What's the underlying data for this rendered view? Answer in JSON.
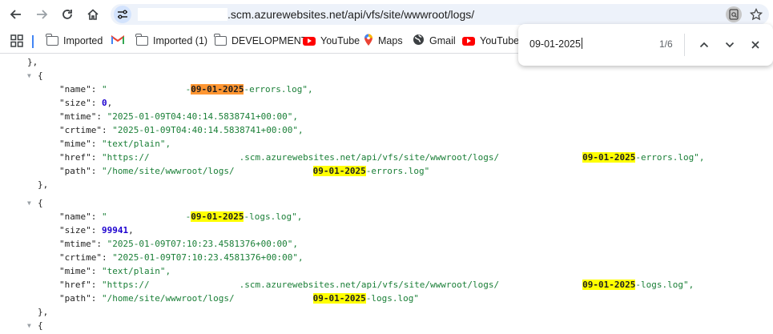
{
  "browser": {
    "url": {
      "visible_text": ".scm.azurewebsites.net/api/vfs/site/wwwroot/logs/"
    },
    "icons": [
      "back-icon",
      "forward-icon",
      "reload-icon",
      "home-icon",
      "site-info-icon",
      "page-search-icon",
      "star-icon"
    ]
  },
  "bookmarks": {
    "items": [
      {
        "label": "Imported",
        "icon": "folder-icon"
      },
      {
        "label": "",
        "icon": "gmail-icon"
      },
      {
        "label": "Imported (1)",
        "icon": "folder-icon"
      },
      {
        "label": "DEVELOPMENT",
        "icon": "folder-icon"
      },
      {
        "label": "YouTube",
        "icon": "youtube-icon"
      },
      {
        "label": "Maps",
        "icon": "maps-icon"
      },
      {
        "label": "Gmail",
        "icon": "globe-icon"
      },
      {
        "label": "YouTube",
        "icon": "youtube-icon"
      }
    ]
  },
  "find": {
    "query": "09-01-2025",
    "count": "1/6"
  },
  "json": {
    "close_obj": "},",
    "open_obj": "{",
    "entry1": {
      "name_key": "\"name\"",
      "name_prefix": "\"",
      "name_dash": "-",
      "date": "09-01-2025",
      "name_suffix": "-errors.log\",",
      "size_key": "\"size\"",
      "size_val": "0",
      "mtime_key": "\"mtime\"",
      "mtime_val": "\"2025-01-09T04:40:14.5838741+00:00\",",
      "crtime_key": "\"crtime\"",
      "crtime_val": "\"2025-01-09T04:40:14.5838741+00:00\",",
      "mime_key": "\"mime\"",
      "mime_val": "\"text/plain\",",
      "href_key": "\"href\"",
      "href_start": "\"https://",
      "href_mid": ".scm.azurewebsites.net/api/vfs/site/wwwroot/logs/",
      "href_suffix": "-errors.log\",",
      "path_key": "\"path\"",
      "path_start": "\"/home/site/wwwroot/logs/",
      "path_suffix": "-errors.log\""
    },
    "entry2": {
      "name_key": "\"name\"",
      "name_prefix": "\"",
      "date": "09-01-2025",
      "name_suffix": "-logs.log\",",
      "size_key": "\"size\"",
      "size_val": "99941",
      "mtime_key": "\"mtime\"",
      "mtime_val": "\"2025-01-09T07:10:23.4581376+00:00\",",
      "crtime_key": "\"crtime\"",
      "crtime_val": "\"2025-01-09T07:10:23.4581376+00:00\",",
      "mime_key": "\"mime\"",
      "mime_val": "\"text/plain\",",
      "href_key": "\"href\"",
      "href_start": "\"https://",
      "href_mid": ".scm.azurewebsites.net/api/vfs/site/wwwroot/logs/",
      "href_suffix": "-logs.log\",",
      "path_key": "\"path\"",
      "path_start": "\"/home/site/wwwroot/logs/",
      "path_suffix": "-logs.log\""
    },
    "colon": ": ",
    "comma": ","
  },
  "colors": {
    "highlight": "#ffff00",
    "active_highlight": "#ff9632",
    "string": "#1a7f37",
    "number": "#1c00cf"
  }
}
